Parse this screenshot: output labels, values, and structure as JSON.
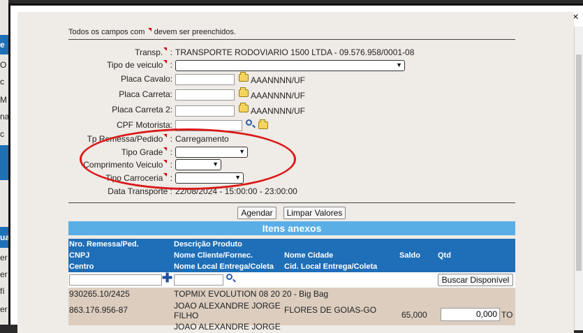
{
  "background": {
    "items": [
      "e",
      "O",
      "c",
      "M",
      "na",
      "c",
      "ua",
      "er",
      "er",
      "fí",
      "er"
    ]
  },
  "close_label": "×",
  "form": {
    "note_prefix": "Todos os campos com",
    "note_suffix": "devem ser preenchidos.",
    "transp_label": "Transp.",
    "transp_value": "TRANSPORTE RODOVIARIO 1500 LTDA - 09.576.958/0001-08",
    "tipo_veiculo_label": "Tipo de veiculo",
    "placa_cavalo_label": "Placa Cavalo:",
    "placa_carreta_label": "Placa Carreta:",
    "placa_carreta2_label": "Placa Carreta 2:",
    "plate_hint": "AAANNNN/UF",
    "cpf_label": "CPF Motorista:",
    "tp_remessa_label": "Tp Remessa/Pedido",
    "tp_remessa_value": "Carregamento",
    "tipo_grade_label": "Tipo Grade",
    "comprimento_label": "Comprimento Veiculo",
    "tipo_carroceria_label": "Tipo Carroceria",
    "data_transporte_label": "Data Transporte",
    "data_transporte_value": "22/08/2024 - 15:00:00 - 23:00:00"
  },
  "buttons": {
    "agendar": "Agendar",
    "limpar": "Limpar Valores",
    "buscar": "Buscar Disponível"
  },
  "itens": {
    "title": "Itens anexos",
    "headers": {
      "col1": [
        "Nro. Remessa/Ped.",
        "CNPJ",
        "Centro"
      ],
      "col2": [
        "Descrição Produto",
        "Nome Cliente/Fornec.",
        "Nome Local Entrega/Coleta"
      ],
      "col3": [
        "Nome Cidade",
        "Cid. Local Entrega/Coleta"
      ],
      "saldo": "Saldo",
      "qtd": "Qtd"
    },
    "row": {
      "remessa": "930265.10/2425",
      "produto": "TOPMIX EVOLUTION 08 20 20 - Big Bag",
      "cnpj": "863.176.956-87",
      "cliente_line1": "JOAO ALEXANDRE JORGE",
      "cliente_line2": "FILHO",
      "cidade": "FLORES DE GOIAS-GO",
      "saldo": "65,000",
      "qtd": "0,000",
      "unit": "TO",
      "local_partial": "JOAO ALEXANDRE JORGE"
    }
  }
}
